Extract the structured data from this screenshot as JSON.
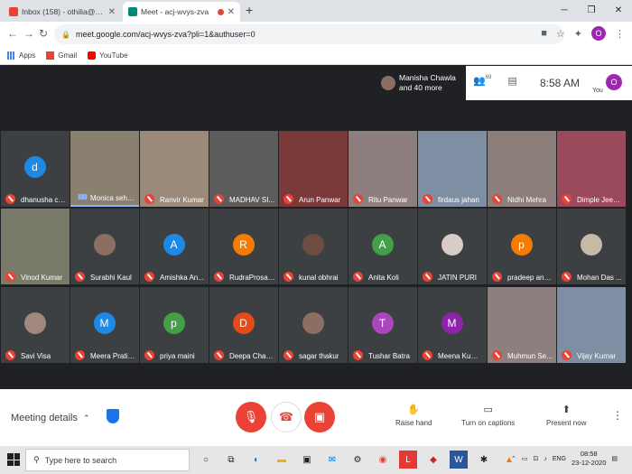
{
  "browser": {
    "tabs": [
      {
        "title": "Inbox (158) - othilia@theindians",
        "active": false
      },
      {
        "title": "Meet - acj-wvys-zva",
        "active": true
      },
      {
        "title": "",
        "active": false
      }
    ],
    "url": "meet.google.com/acj-wvys-zva?pli=1&authuser=0",
    "profile_initial": "O",
    "bookmarks": [
      "Apps",
      "Gmail",
      "YouTube"
    ]
  },
  "meet": {
    "presenter_line1": "Manisha Chawla",
    "presenter_line2": "and 40 more",
    "participant_count": "69",
    "time": "8:58 AM",
    "you_label": "You",
    "you_initial": "O",
    "tiles": [
      {
        "name": "dhanusha ch...",
        "initial": "d",
        "color": "#1e88e5",
        "type": "letter"
      },
      {
        "name": "Monica sehgal",
        "type": "video",
        "speaking": true
      },
      {
        "name": "Ranvir Kumar",
        "type": "video"
      },
      {
        "name": "MADHAV SI...",
        "type": "video"
      },
      {
        "name": "Arun Panwar",
        "type": "video"
      },
      {
        "name": "Ritu Panwar",
        "type": "video"
      },
      {
        "name": "firdaus jahan",
        "type": "video"
      },
      {
        "name": "Nidhi Mehra",
        "type": "video"
      },
      {
        "name": "Dimple Jeen...",
        "type": "video"
      },
      {
        "name": "Vinod Kumar",
        "type": "video"
      },
      {
        "name": "Surabhi Kaul",
        "type": "photo"
      },
      {
        "name": "Amishka An...",
        "initial": "A",
        "color": "#1e88e5",
        "type": "letter"
      },
      {
        "name": "RudraProsad...",
        "initial": "R",
        "color": "#f57c00",
        "type": "letter"
      },
      {
        "name": "kunal obhrai",
        "type": "photo"
      },
      {
        "name": "Anita Koli",
        "initial": "A",
        "color": "#43a047",
        "type": "letter"
      },
      {
        "name": "JATIN PURI",
        "type": "photo"
      },
      {
        "name": "pradeep aneja",
        "initial": "p",
        "color": "#f57c00",
        "type": "letter"
      },
      {
        "name": "Mohan Das ...",
        "type": "photo"
      },
      {
        "name": "Savi Visa",
        "type": "photo"
      },
      {
        "name": "Meera Pratih...",
        "initial": "M",
        "color": "#1e88e5",
        "type": "letter"
      },
      {
        "name": "priya maini",
        "initial": "p",
        "color": "#43a047",
        "type": "letter"
      },
      {
        "name": "Deepa Chakr...",
        "initial": "D",
        "color": "#e64a19",
        "type": "letter"
      },
      {
        "name": "sagar thakur",
        "type": "photo"
      },
      {
        "name": "Tushar Batra",
        "initial": "T",
        "color": "#ab47bc",
        "type": "letter"
      },
      {
        "name": "Meena Kumari",
        "initial": "M",
        "color": "#8e24aa",
        "type": "letter"
      },
      {
        "name": "Muhmun Se...",
        "type": "video"
      },
      {
        "name": "Vijay Kumar",
        "type": "video"
      }
    ]
  },
  "controls": {
    "meeting_details": "Meeting details",
    "raise_hand": "Raise hand",
    "captions": "Turn on captions",
    "present": "Present now"
  },
  "taskbar": {
    "search_placeholder": "Type here to search",
    "lang": "ENG",
    "time": "08:58",
    "date": "23-12-2020"
  }
}
